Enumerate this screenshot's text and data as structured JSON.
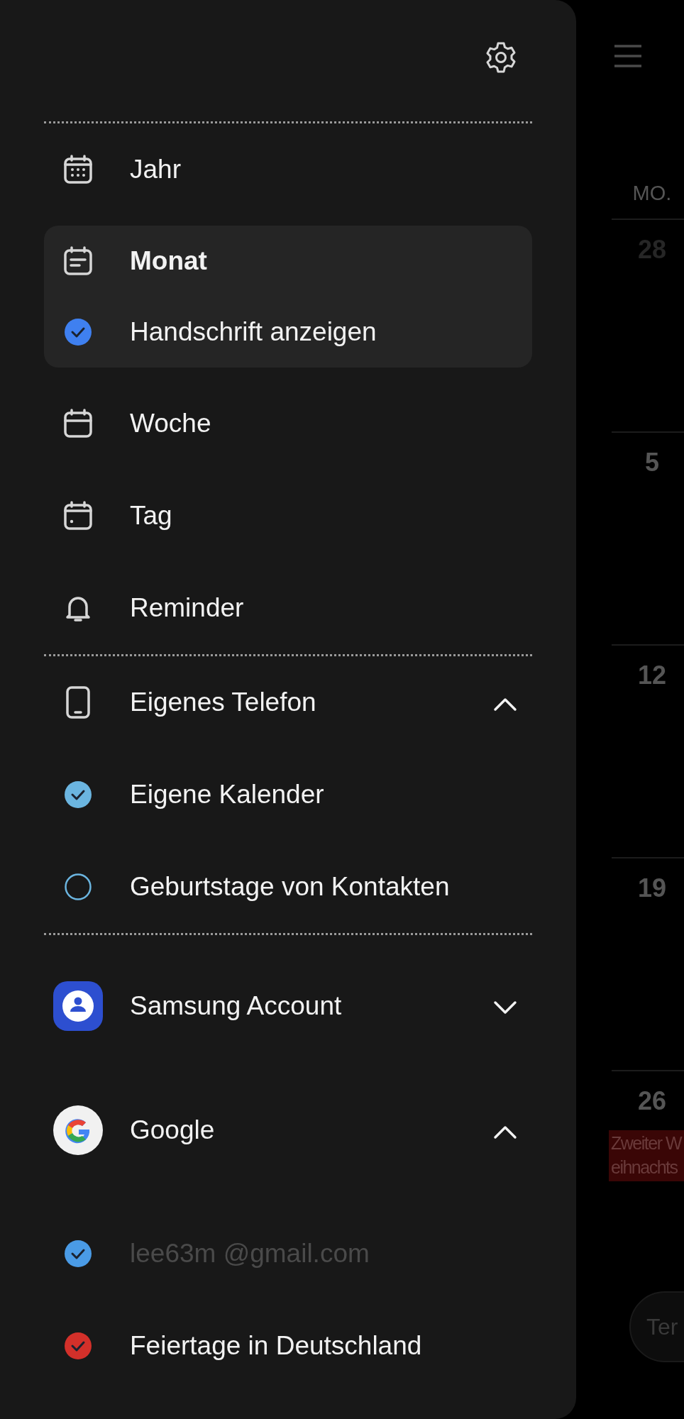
{
  "views": [
    {
      "kind": "year",
      "label": "Jahr",
      "selected": false
    },
    {
      "kind": "month",
      "label": "Monat",
      "selected": true,
      "option": {
        "label": "Handschrift anzeigen",
        "checked": true,
        "color": "#3f80f0"
      }
    },
    {
      "kind": "week",
      "label": "Woche",
      "selected": false
    },
    {
      "kind": "day",
      "label": "Tag",
      "selected": false
    },
    {
      "kind": "reminder",
      "label": "Reminder",
      "selected": false
    }
  ],
  "phone": {
    "label": "Eigenes Telefon",
    "expanded": true,
    "calendars": [
      {
        "label": "Eigene Kalender",
        "checked": true,
        "color": "#6bb5e0"
      },
      {
        "label": "Geburtstage von Kontakten",
        "checked": false,
        "color": "#6bb5e0"
      }
    ]
  },
  "accounts": [
    {
      "kind": "samsung",
      "name": "Samsung Account",
      "expanded": false
    },
    {
      "kind": "google",
      "name": "Google",
      "expanded": true,
      "calendars": [
        {
          "label": "lee63m @gmail.com",
          "checked": true,
          "dimmed": true,
          "color": "#4a9be6"
        },
        {
          "label": "Feiertage in Deutschland",
          "checked": true,
          "dimmed": false,
          "color": "#d3302a"
        }
      ]
    }
  ],
  "calendar": {
    "weekday": "MO.",
    "weeks": [
      {
        "day": "28",
        "other_month": true
      },
      {
        "day": "5",
        "other_month": false
      },
      {
        "day": "12",
        "other_month": false
      },
      {
        "day": "19",
        "other_month": false
      },
      {
        "day": "26",
        "other_month": false,
        "events": [
          {
            "lines": [
              "Zweiter W",
              "eihnachts"
            ],
            "color": "#3a0606"
          }
        ]
      }
    ],
    "button": "Ter"
  }
}
